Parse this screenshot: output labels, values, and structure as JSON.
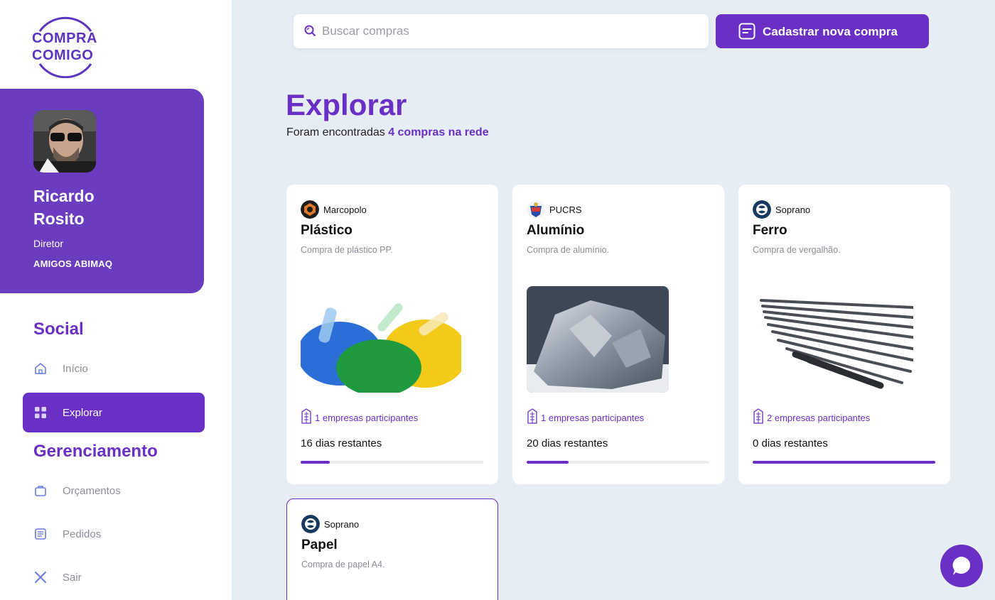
{
  "app": {
    "logo_line1": "COMPRA",
    "logo_line2": "COMIGO",
    "brand_color": "#6a2fc4"
  },
  "profile": {
    "name": "Ricardo Rosito",
    "role": "Diretor",
    "organization": "AMIGOS ABIMAQ"
  },
  "sidebar": {
    "sections": [
      {
        "title": "Social"
      },
      {
        "title": "Gerenciamento"
      }
    ],
    "items": [
      {
        "label": "Início",
        "icon": "home-icon",
        "active": false
      },
      {
        "label": "Explorar",
        "icon": "grid-icon",
        "active": true
      },
      {
        "label": "Orçamentos",
        "icon": "briefcase-icon",
        "active": false
      },
      {
        "label": "Pedidos",
        "icon": "document-icon",
        "active": false
      },
      {
        "label": "Sair",
        "icon": "close-icon",
        "active": false
      }
    ]
  },
  "topbar": {
    "search_placeholder": "Buscar compras",
    "search_value": "",
    "new_button_label": "Cadastrar nova compra"
  },
  "main": {
    "title": "Explorar",
    "found_prefix": "Foram encontradas ",
    "found_highlight": "4 compras na rede"
  },
  "cards": [
    {
      "company": "Marcopolo",
      "title": "Plástico",
      "description": "Compra de plástico PP.",
      "participants": "1 empresas participantes",
      "days_left": "16 dias restantes",
      "progress": 0.16
    },
    {
      "company": "PUCRS",
      "title": "Alumínio",
      "description": "Compra de alumínio.",
      "participants": "1 empresas participantes",
      "days_left": "20 dias restantes",
      "progress": 0.23
    },
    {
      "company": "Soprano",
      "title": "Ferro",
      "description": "Compra de vergalhão.",
      "participants": "2 empresas participantes",
      "days_left": "0 dias restantes",
      "progress": 1.0
    },
    {
      "company": "Soprano",
      "title": "Papel",
      "description": "Compra de papel A4."
    }
  ]
}
